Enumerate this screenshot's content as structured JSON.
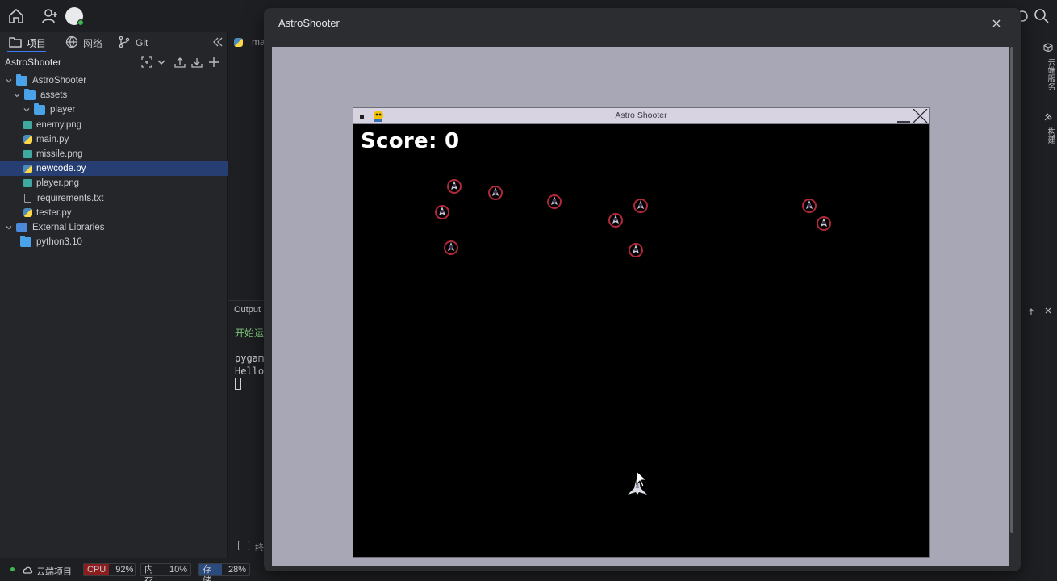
{
  "sidebar": {
    "tabs": [
      {
        "label": "项目",
        "icon": "folder-icon"
      },
      {
        "label": "网络",
        "icon": "globe-icon"
      },
      {
        "label": "Git",
        "icon": "git-branch-icon"
      }
    ],
    "project_name": "AstroShooter",
    "tree": [
      {
        "label": "AstroShooter",
        "type": "folder",
        "depth": 0,
        "expanded": true
      },
      {
        "label": "assets",
        "type": "folder",
        "depth": 1,
        "expanded": true
      },
      {
        "label": "player",
        "type": "folder",
        "depth": 2,
        "expanded": true
      },
      {
        "label": "enemy.png",
        "type": "image",
        "depth": 1
      },
      {
        "label": "main.py",
        "type": "python",
        "depth": 1
      },
      {
        "label": "missile.png",
        "type": "image",
        "depth": 1
      },
      {
        "label": "newcode.py",
        "type": "python",
        "depth": 1,
        "selected": true
      },
      {
        "label": "player.png",
        "type": "image",
        "depth": 1
      },
      {
        "label": "requirements.txt",
        "type": "text",
        "depth": 1
      },
      {
        "label": "tester.py",
        "type": "python",
        "depth": 1
      },
      {
        "label": "External Libraries",
        "type": "library",
        "depth": 0,
        "expanded": true
      },
      {
        "label": "python3.10",
        "type": "folder",
        "depth": 1
      }
    ]
  },
  "editor": {
    "tab_label": "ma",
    "output_label": "Output",
    "console_lines": [
      "开始运",
      "",
      "pygam",
      "Hello"
    ],
    "terminal_label": "终"
  },
  "right_strip": {
    "cloud_service": "云端服务",
    "build": "构建"
  },
  "statusbar": {
    "cloud_project": "云端项目",
    "cpu_label": "CPU",
    "cpu_value": "92%",
    "mem_label": "内存",
    "mem_value": "10%",
    "storage_label": "存储",
    "storage_value": "28%"
  },
  "dialog": {
    "title": "AstroShooter"
  },
  "game": {
    "window_title": "Astro Shooter",
    "score_text": "Score: 0"
  },
  "colors": {
    "accent": "#3d7bf5",
    "selection": "#263e72",
    "status_green": "#3fb950",
    "canvas_bg": "#a7a7b6"
  }
}
